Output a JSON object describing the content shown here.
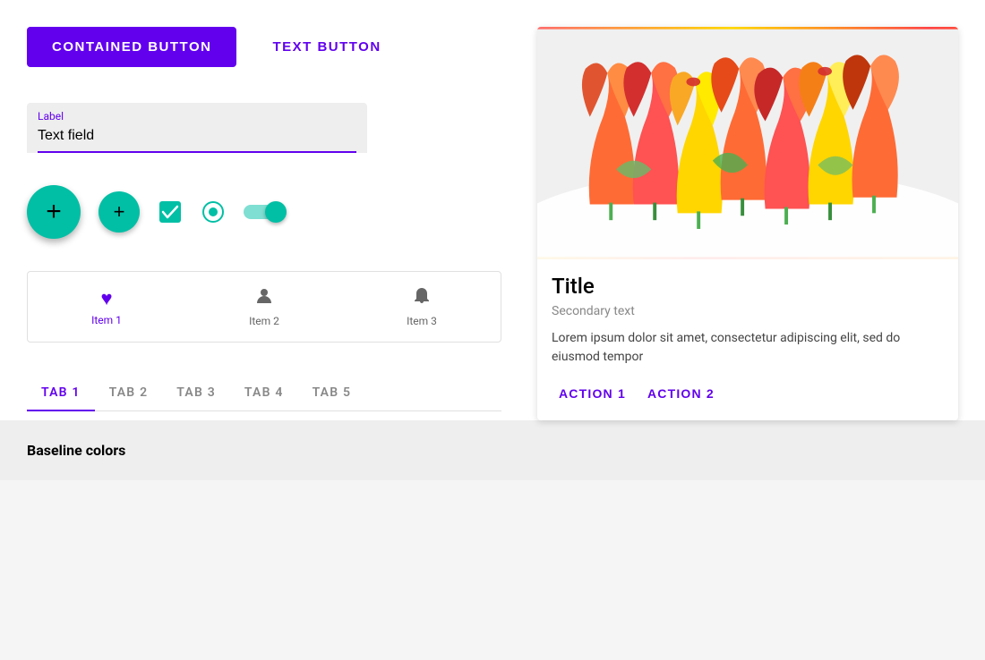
{
  "buttons": {
    "contained_label": "CONTAINED BUTTON",
    "text_label": "TEXT BUTTON"
  },
  "textField": {
    "label": "Label",
    "value": "Text field"
  },
  "bottomNav": {
    "items": [
      {
        "id": "item1",
        "label": "Item 1",
        "icon": "heart",
        "active": true
      },
      {
        "id": "item2",
        "label": "Item 2",
        "icon": "person",
        "active": false
      },
      {
        "id": "item3",
        "label": "Item 3",
        "icon": "bell",
        "active": false
      }
    ]
  },
  "tabs": [
    {
      "id": "tab1",
      "label": "TAB 1",
      "active": true
    },
    {
      "id": "tab2",
      "label": "TAB 2",
      "active": false
    },
    {
      "id": "tab3",
      "label": "TAB 3",
      "active": false
    },
    {
      "id": "tab4",
      "label": "TAB 4",
      "active": false
    },
    {
      "id": "tab5",
      "label": "TAB 5",
      "active": false
    }
  ],
  "card": {
    "title": "Title",
    "secondary": "Secondary text",
    "body": "Lorem ipsum dolor sit amet, consectetur adipiscing elit, sed do eiusmod tempor",
    "action1": "ACTION 1",
    "action2": "ACTION 2"
  },
  "baseline": {
    "title": "Baseline colors"
  },
  "colors": {
    "primary": "#6200ee",
    "teal": "#00bfa5"
  }
}
